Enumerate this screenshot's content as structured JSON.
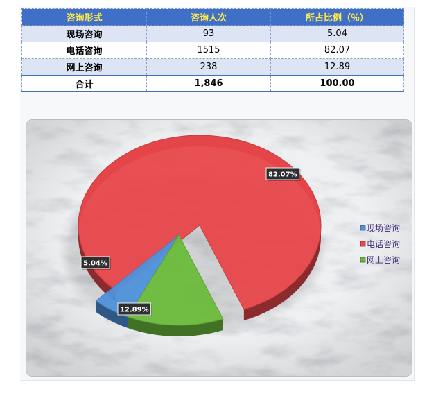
{
  "table": {
    "headers": [
      "咨询形式",
      "咨询人次",
      "所占比例（％）"
    ],
    "rows": [
      {
        "form": "现场咨询",
        "count": "93",
        "pct": "5.04"
      },
      {
        "form": "电话咨询",
        "count": "1515",
        "pct": "82.07"
      },
      {
        "form": "网上咨询",
        "count": "238",
        "pct": "12.89"
      }
    ],
    "total": {
      "label": "合计",
      "count": "1,846",
      "pct": "100.00"
    }
  },
  "chart_data": {
    "type": "pie",
    "style": "3d-exploded",
    "title": "",
    "categories": [
      "现场咨询",
      "电话咨询",
      "网上咨询"
    ],
    "values": [
      5.04,
      82.07,
      12.89
    ],
    "labels": [
      "5.04%",
      "82.07%",
      "12.89%"
    ],
    "colors": [
      "#4f93dc",
      "#e8474b",
      "#6cbc3c"
    ],
    "legend_position": "right",
    "background": "marble-texture"
  }
}
